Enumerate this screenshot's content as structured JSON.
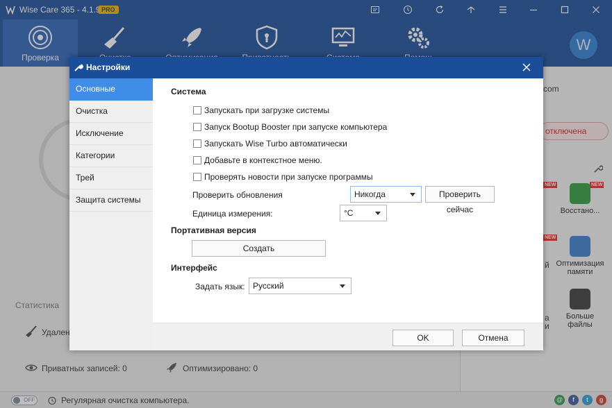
{
  "app": {
    "title": "Wise Care 365 - 4.1.9",
    "badge": "PRO",
    "accent_color": "#1a4d9a",
    "titlebar_icons": [
      "feedback-icon",
      "history-icon",
      "refresh-icon",
      "skin-icon",
      "menu-icon",
      "minimize-icon",
      "maximize-icon",
      "close-icon"
    ]
  },
  "nav": {
    "items": [
      {
        "label": "Проверка",
        "icon": "scan-icon"
      },
      {
        "label": "Очистка",
        "icon": "broom-icon"
      },
      {
        "label": "Оптимизация",
        "icon": "rocket-icon"
      },
      {
        "label": "Приватность",
        "icon": "shield-icon"
      },
      {
        "label": "Система",
        "icon": "monitor-icon"
      },
      {
        "label": "Помощ",
        "icon": "gears-icon"
      }
    ],
    "avatar_letter": "W"
  },
  "background": {
    "right_url_fragment": "com",
    "protection_status": "отключена",
    "stats_title": "Статистика",
    "stat_deleted": "Удален",
    "stat_private": "Приватных записей: 0",
    "stat_optimized": "Оптимизировано: 0",
    "tools": [
      {
        "label": "Восстано...",
        "badge": "NEW",
        "color": "#2e9b3c"
      },
      {
        "label": "Оптимизация памяти",
        "badge": "",
        "color": "#3a7fd0"
      },
      {
        "label": "Больше файлы",
        "badge": "",
        "color": "#3b3b3b"
      }
    ],
    "partial_labels": [
      "й",
      "а",
      "и"
    ],
    "new_badge": "NEW"
  },
  "status_bar": {
    "toggle_label": "OFF",
    "text": "Регулярная очистка компьютера.",
    "social": [
      "email-icon",
      "facebook-icon",
      "twitter-icon",
      "google-plus-icon"
    ]
  },
  "dialog": {
    "title": "Настройки",
    "sidebar": [
      "Основные",
      "Очистка",
      "Исключение",
      "Категории",
      "Трей",
      "Защита системы"
    ],
    "system": {
      "title": "Система",
      "checkboxes": [
        "Запускать при загрузке системы",
        "Запуск Bootup Booster при запуске компьютера",
        "Запускать Wise Turbo автоматически",
        "Добавьте в контекстное меню.",
        "Проверять новости при запуске программы"
      ],
      "update_label": "Проверить обновления",
      "update_value": "Никогда",
      "check_now": "Проверить сейчас",
      "unit_label": "Единица измерения:",
      "unit_value": "°C"
    },
    "portable": {
      "title": "Портативная версия",
      "create": "Создать"
    },
    "interface": {
      "title": "Интерфейс",
      "lang_label": "Задать язык:",
      "lang_value": "Русский"
    },
    "ok": "OK",
    "cancel": "Отмена"
  }
}
